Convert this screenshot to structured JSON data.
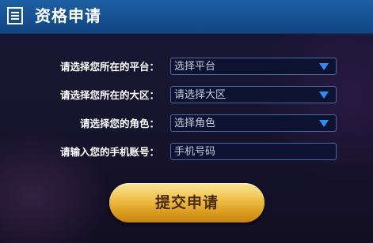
{
  "header": {
    "title": "资格申请",
    "icon": "document-list-icon"
  },
  "form": {
    "platform": {
      "label": "请选择您所在的平台：",
      "value": "选择平台",
      "icon": "dropdown-arrow-icon"
    },
    "region": {
      "label": "请选择您所在的大区：",
      "value": "请选择大区",
      "icon": "dropdown-arrow-icon"
    },
    "role": {
      "label": "请选择您的角色：",
      "value": "选择角色",
      "icon": "dropdown-arrow-icon"
    },
    "phone": {
      "label": "请输入您的手机账号：",
      "placeholder": "手机号码"
    }
  },
  "submit": {
    "label": "提交申请"
  },
  "colors": {
    "header_bg": "#1a5799",
    "accent_arrow": "#2f8cf0",
    "button_gold": "#e8b53a"
  }
}
